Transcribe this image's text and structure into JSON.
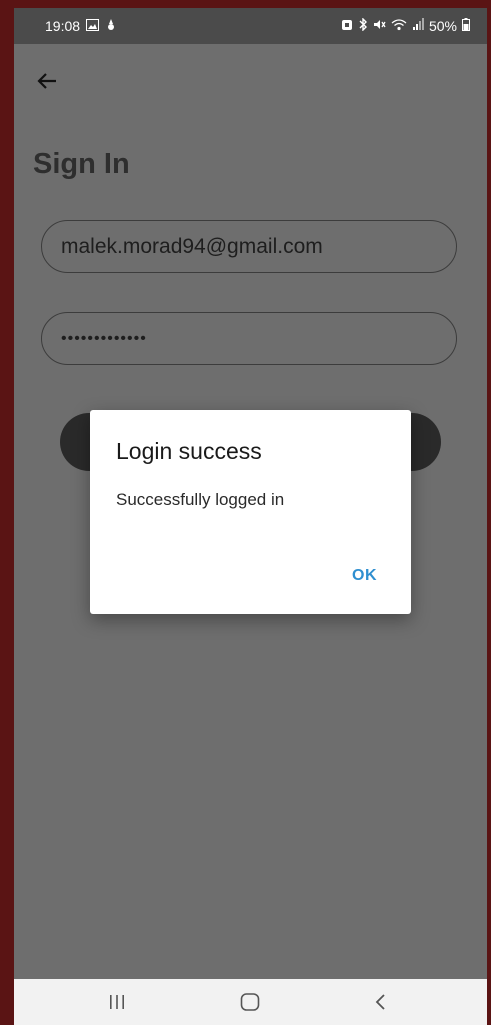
{
  "status_bar": {
    "time": "19:08",
    "left_icons": [
      "image-icon",
      "notification-icon"
    ],
    "right_icons": [
      "alarm-icon",
      "bluetooth-icon",
      "mute-icon",
      "wifi-icon",
      "signal-icon"
    ],
    "battery": "50%"
  },
  "header": {
    "back_icon": "arrow-left-icon"
  },
  "page": {
    "title": "Sign In",
    "email_value": "malek.morad94@gmail.com",
    "password_value": "•••••••••••••"
  },
  "dialog": {
    "title": "Login success",
    "message": "Successfully logged in",
    "ok_label": "OK"
  },
  "nav_bar": {
    "items": [
      "recents-icon",
      "home-icon",
      "back-icon"
    ]
  },
  "colors": {
    "overlay": "#6e6e6e",
    "status_bar": "#4b4b4b",
    "accent": "#2f8fd0",
    "frame": "#5a1414"
  }
}
